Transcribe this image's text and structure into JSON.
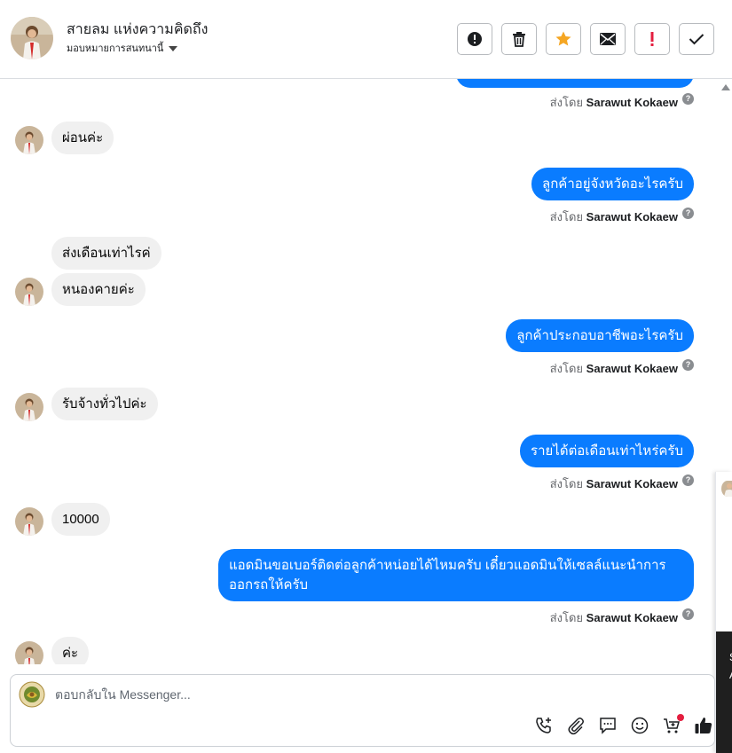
{
  "header": {
    "contact_name": "สายลม แห่งความคิดถึง",
    "assign_label": "มอบหมายการสนทนานี้",
    "actions": [
      {
        "name": "report-spam-button",
        "icon": "alert-circle-icon"
      },
      {
        "name": "delete-button",
        "icon": "trash-icon"
      },
      {
        "name": "star-button",
        "icon": "star-icon"
      },
      {
        "name": "mark-unread-button",
        "icon": "envelope-icon"
      },
      {
        "name": "important-button",
        "icon": "exclamation-icon"
      },
      {
        "name": "mark-done-button",
        "icon": "check-icon"
      }
    ]
  },
  "colors": {
    "outgoing_bubble": "#0a7cff",
    "incoming_bubble": "#f0f0f0",
    "star": "#f5a623",
    "exclamation": "#e41e3f"
  },
  "messages": [
    {
      "direction": "out",
      "text": "",
      "sent_by_prefix": "ส่งโดย",
      "sent_by_name": "Sarawut Kokaew"
    },
    {
      "direction": "in",
      "text": "ผ่อนค่ะ"
    },
    {
      "direction": "out",
      "text": "ลูกค้าอยู่จังหวัดอะไรครับ",
      "sent_by_prefix": "ส่งโดย",
      "sent_by_name": "Sarawut Kokaew"
    },
    {
      "direction": "in",
      "text": "ส่งเดือนเท่าไรค่"
    },
    {
      "direction": "in",
      "text": "หนองคายค่ะ"
    },
    {
      "direction": "out",
      "text": "ลูกค้าประกอบอาชีพอะไรครับ",
      "sent_by_prefix": "ส่งโดย",
      "sent_by_name": "Sarawut Kokaew"
    },
    {
      "direction": "in",
      "text": "รับจ้างทั่วไปค่ะ"
    },
    {
      "direction": "out",
      "text": "รายได้ต่อเดือนเท่าไหร่ครับ",
      "sent_by_prefix": "ส่งโดย",
      "sent_by_name": "Sarawut Kokaew"
    },
    {
      "direction": "in",
      "text": "10000"
    },
    {
      "direction": "out",
      "text": "แอดมินขอเบอร์ติดต่อลูกค้าหน่อยได้ไหมครับ เดี๋ยวแอดมินให้เซลล์แนะนำการออกรถให้ครับ",
      "sent_by_prefix": "ส่งโดย",
      "sent_by_name": "Sarawut Kokaew"
    },
    {
      "direction": "in",
      "text": "ค่ะ"
    }
  ],
  "side_strip": {
    "letter_1": "S",
    "letter_2": "A"
  },
  "composer": {
    "placeholder": "ตอบกลับใน Messenger...",
    "tools": [
      "phone-plus-icon",
      "paperclip-icon",
      "saved-reply-icon",
      "emoji-icon",
      "cart-plus-icon",
      "thumbs-up-icon"
    ]
  }
}
